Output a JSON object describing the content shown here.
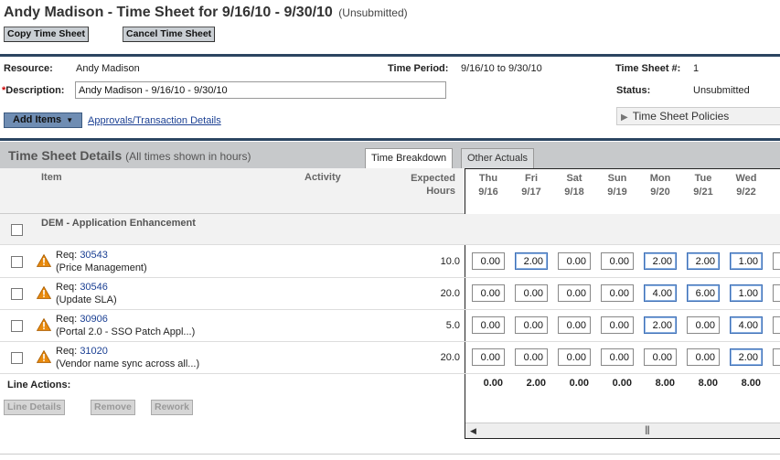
{
  "header": {
    "title": "Andy Madison - Time Sheet for 9/16/10 - 9/30/10",
    "status_suffix": "(Unsubmitted)",
    "copy_button": "Copy Time Sheet",
    "cancel_button": "Cancel Time Sheet"
  },
  "info": {
    "resource_label": "Resource:",
    "resource_value": "Andy Madison",
    "time_period_label": "Time Period:",
    "time_period_value": "9/16/10 to 9/30/10",
    "timesheet_num_label": "Time Sheet #:",
    "timesheet_num_value": "1",
    "description_required": "*",
    "description_label": "Description:",
    "description_value": "Andy Madison - 9/16/10 - 9/30/10",
    "status_label": "Status:",
    "status_value": "Unsubmitted",
    "add_items_label": "Add Items",
    "approvals_link": "Approvals/Transaction Details",
    "policies_label": "Time Sheet Policies"
  },
  "details": {
    "title": "Time Sheet Details",
    "note": "(All times shown in hours)",
    "tabs": [
      "Time Breakdown",
      "Other Actuals"
    ],
    "columns": {
      "item": "Item",
      "activity": "Activity",
      "expected_line1": "Expected",
      "expected_line2": "Hours"
    },
    "days": [
      {
        "dow": "Thu",
        "date": "9/16"
      },
      {
        "dow": "Fri",
        "date": "9/17"
      },
      {
        "dow": "Sat",
        "date": "9/18"
      },
      {
        "dow": "Sun",
        "date": "9/19"
      },
      {
        "dow": "Mon",
        "date": "9/20"
      },
      {
        "dow": "Tue",
        "date": "9/21"
      },
      {
        "dow": "Wed",
        "date": "9/22"
      }
    ],
    "group": "DEM - Application Enhancement",
    "rows": [
      {
        "req_prefix": "Req:",
        "req_num": "30543",
        "name": "(Price Management)",
        "expected": "10.0",
        "hours": [
          "0.00",
          "2.00",
          "0.00",
          "0.00",
          "2.00",
          "2.00",
          "1.00"
        ]
      },
      {
        "req_prefix": "Req:",
        "req_num": "30546",
        "name": "(Update SLA)",
        "expected": "20.0",
        "hours": [
          "0.00",
          "0.00",
          "0.00",
          "0.00",
          "4.00",
          "6.00",
          "1.00"
        ]
      },
      {
        "req_prefix": "Req:",
        "req_num": "30906",
        "name": "(Portal 2.0 - SSO Patch Appl...)",
        "expected": "5.0",
        "hours": [
          "0.00",
          "0.00",
          "0.00",
          "0.00",
          "2.00",
          "0.00",
          "4.00"
        ]
      },
      {
        "req_prefix": "Req:",
        "req_num": "31020",
        "name": "(Vendor name sync across all...)",
        "expected": "20.0",
        "hours": [
          "0.00",
          "0.00",
          "0.00",
          "0.00",
          "0.00",
          "0.00",
          "2.00"
        ]
      }
    ],
    "line_actions_label": "Line Actions:",
    "totals": [
      "0.00",
      "2.00",
      "0.00",
      "0.00",
      "8.00",
      "8.00",
      "8.00"
    ],
    "buttons": {
      "line_details": "Line Details",
      "remove": "Remove",
      "rework": "Rework"
    }
  },
  "colors": {
    "accent_bar": "#2b4561",
    "add_items_bg": "#6f8db3",
    "link": "#1a3f93",
    "warning": "#e8890c"
  }
}
